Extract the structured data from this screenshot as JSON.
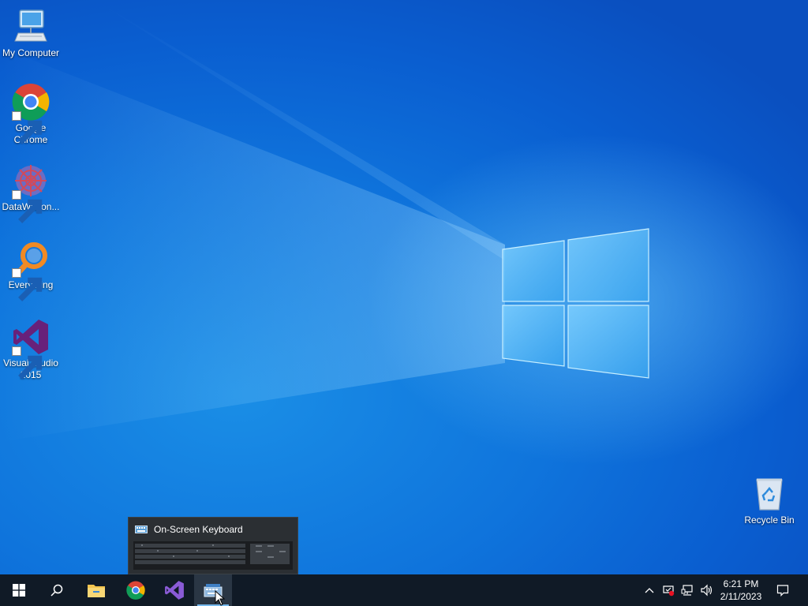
{
  "desktop": {
    "icons": [
      {
        "label": "My Computer",
        "icon": "computer-icon"
      },
      {
        "label": "Google\nChrome",
        "icon": "chrome-icon"
      },
      {
        "label": "DataWagon...",
        "icon": "datawagon-icon"
      },
      {
        "label": "Everything",
        "icon": "everything-search-icon"
      },
      {
        "label": "Visual Studio\n2015",
        "icon": "visual-studio-icon"
      },
      {
        "label": "Recycle Bin",
        "icon": "recycle-bin-icon"
      }
    ]
  },
  "thumbnail_preview": {
    "title": "On-Screen Keyboard",
    "icon": "keyboard-icon"
  },
  "taskbar": {
    "buttons": [
      {
        "name": "start",
        "icon": "windows-logo-icon"
      },
      {
        "name": "search",
        "icon": "search-icon"
      },
      {
        "name": "file-explorer",
        "icon": "folder-icon"
      },
      {
        "name": "chrome",
        "icon": "chrome-icon"
      },
      {
        "name": "visual-studio",
        "icon": "visual-studio-icon"
      },
      {
        "name": "on-screen-keyboard",
        "icon": "keyboard-icon",
        "active": true
      }
    ],
    "tray": {
      "icons": [
        "chevron-up-icon",
        "security-icon",
        "network-icon",
        "volume-icon"
      ],
      "time": "6:21 PM",
      "date": "2/11/2023",
      "notification_icon": "action-center-icon"
    }
  },
  "colors": {
    "desktop_blue": "#0f74dc",
    "taskbar": "#101a26",
    "accent": "#76b9ed"
  }
}
